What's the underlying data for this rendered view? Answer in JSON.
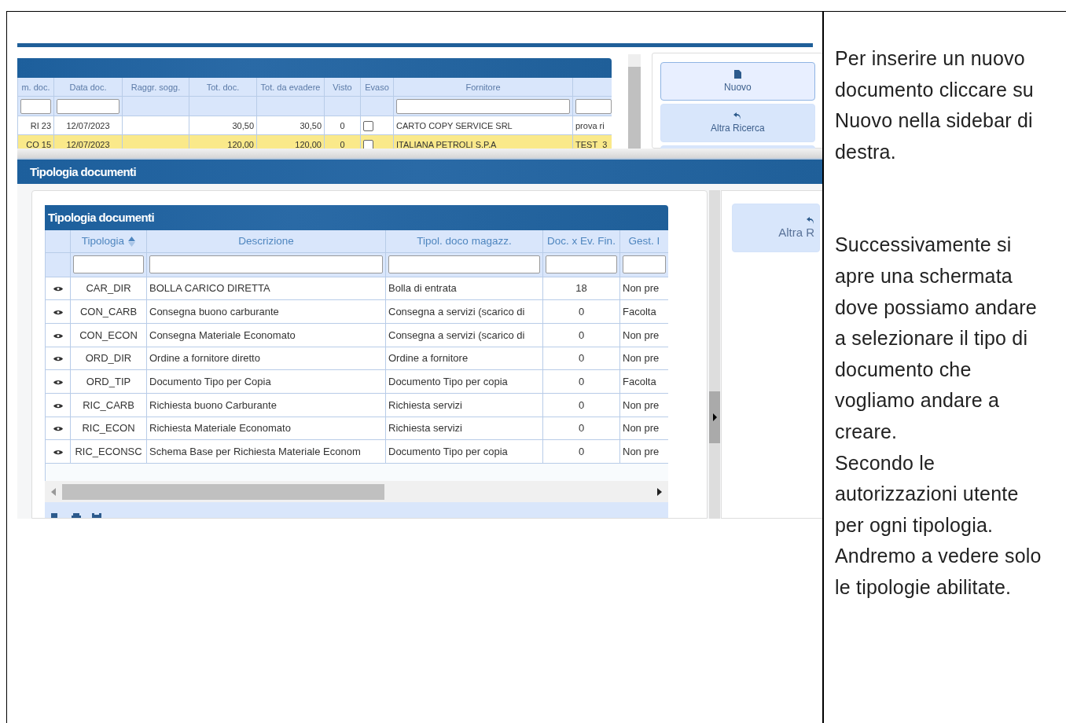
{
  "screenshot": {
    "list": {
      "columns": [
        {
          "label": "m. doc.",
          "filter": true
        },
        {
          "label": "Data doc.",
          "filter": true
        },
        {
          "label": "Raggr. sogg.",
          "filter": false
        },
        {
          "label": "Tot. doc.",
          "filter": false
        },
        {
          "label": "Tot. da evadere",
          "filter": false
        },
        {
          "label": "Visto",
          "filter": false
        },
        {
          "label": "Evaso",
          "filter": false
        },
        {
          "label": "Fornitore",
          "filter": true
        },
        {
          "filter": true
        }
      ],
      "rows": [
        {
          "selected": false,
          "num_doc": "RI 23",
          "data_doc": "12/07/2023",
          "tot_doc": "30,50",
          "tot_da_evadere": "30,50",
          "visto": "0",
          "evaso": false,
          "fornitore": "CARTO COPY SERVICE SRL",
          "column_9": "prova ri"
        },
        {
          "selected": true,
          "num_doc": "CO 15",
          "data_doc": "12/07/2023",
          "tot_doc": "120,00",
          "tot_da_evadere": "120,00",
          "visto": "0",
          "evaso": false,
          "fornitore": "ITALIANA PETROLI S.P.A",
          "column_9": "TEST_3"
        }
      ]
    },
    "sidebar_buttons": [
      {
        "kind": "new",
        "label": "Nuovo"
      },
      {
        "kind": "back",
        "label": "Altra Ricerca"
      },
      {
        "kind": "blank"
      }
    ],
    "dialog": {
      "title": "Tipologia documenti",
      "grid": {
        "title": "Tipologia documenti",
        "columns": [
          {
            "label": "Tipologia",
            "sorted": true
          },
          {
            "label": "Descrizione",
            "sorted": false
          },
          {
            "label": "Tipol. doco magazz.",
            "sorted": false
          },
          {
            "label": "Doc. x Ev. Fin.",
            "sorted": false
          },
          {
            "label": "Gest. I",
            "sorted": false
          }
        ],
        "rows": [
          {
            "tipologia": "CAR_DIR",
            "descrizione": "BOLLA CARICO DIRETTA",
            "tipol_magazz": "Bolla di entrata",
            "doc_ev_fin": "18",
            "gest": "Non pre"
          },
          {
            "tipologia": "CON_CARB",
            "descrizione": "Consegna buono carburante",
            "tipol_magazz": "Consegna a servizi (scarico di",
            "doc_ev_fin": "0",
            "gest": "Facolta"
          },
          {
            "tipologia": "CON_ECON",
            "descrizione": "Consegna Materiale Economato",
            "tipol_magazz": "Consegna a servizi (scarico di",
            "doc_ev_fin": "0",
            "gest": "Non pre"
          },
          {
            "tipologia": "ORD_DIR",
            "descrizione": "Ordine a fornitore diretto",
            "tipol_magazz": "Ordine a fornitore",
            "doc_ev_fin": "0",
            "gest": "Non pre"
          },
          {
            "tipologia": "ORD_TIP",
            "descrizione": "Documento Tipo per Copia",
            "tipol_magazz": "Documento Tipo per copia",
            "doc_ev_fin": "0",
            "gest": "Facolta"
          },
          {
            "tipologia": "RIC_CARB",
            "descrizione": "Richiesta  buono  Carburante",
            "tipol_magazz": "Richiesta servizi",
            "doc_ev_fin": "0",
            "gest": "Non pre"
          },
          {
            "tipologia": "RIC_ECON",
            "descrizione": "Richiesta Materiale Economato",
            "tipol_magazz": "Richiesta servizi",
            "doc_ev_fin": "0",
            "gest": "Non pre"
          },
          {
            "tipologia": "RIC_ECONSC",
            "descrizione": "Schema Base per Richiesta Materiale Econom",
            "tipol_magazz": "Documento Tipo per copia",
            "doc_ev_fin": "0",
            "gest": "Non pre"
          }
        ]
      },
      "side_buttons": [
        {
          "kind": "back",
          "label": "Altra R"
        }
      ]
    }
  },
  "explanation": [
    "Per inserire un nuovo documento cliccare su Nuovo nella sidebar di destra.",
    "Successivamente si apre una schermata dove possiamo andare a selezionare il tipo di documento che vogliamo andare a creare.",
    "Secondo le autorizzazioni utente per ogni tipologia.",
    "Andremo a vedere solo le tipologie abilitate."
  ]
}
